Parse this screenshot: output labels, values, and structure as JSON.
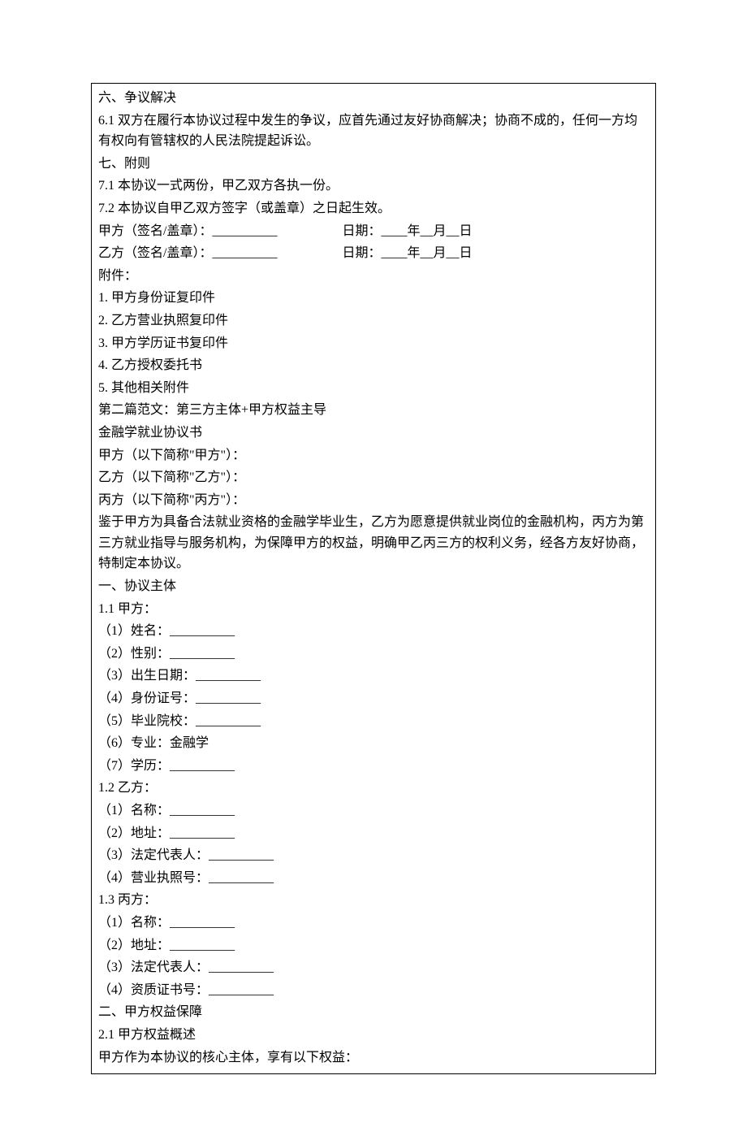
{
  "lines": [
    "六、争议解决",
    "6.1 双方在履行本协议过程中发生的争议，应首先通过友好协商解决；协商不成的，任何一方均有权向有管辖权的人民法院提起诉讼。",
    "七、附则",
    "7.1 本协议一式两份，甲乙双方各执一份。",
    "7.2 本协议自甲乙双方签字（或盖章）之日起生效。",
    "甲方（签名/盖章）：__________     日期：____年__月__日",
    "乙方（签名/盖章）：__________     日期：____年__月__日",
    "附件：",
    "1. 甲方身份证复印件",
    "2. 乙方营业执照复印件",
    "3. 甲方学历证书复印件",
    "4. 乙方授权委托书",
    "5. 其他相关附件",
    "第二篇范文：第三方主体+甲方权益主导",
    "金融学就业协议书",
    "甲方（以下简称\"甲方\"）：",
    "乙方（以下简称\"乙方\"）：",
    "丙方（以下简称\"丙方\"）：",
    "鉴于甲方为具备合法就业资格的金融学毕业生，乙方为愿意提供就业岗位的金融机构，丙方为第三方就业指导与服务机构，为保障甲方的权益，明确甲乙丙三方的权利义务，经各方友好协商，特制定本协议。",
    "一、协议主体",
    "1.1 甲方：",
    "（1）姓名：__________",
    "（2）性别：__________",
    "（3）出生日期：__________",
    "（4）身份证号：__________",
    "（5）毕业院校：__________",
    "（6）专业：金融学",
    "（7）学历：__________",
    "1.2 乙方：",
    "（1）名称：__________",
    "（2）地址：__________",
    "（3）法定代表人：__________",
    "（4）营业执照号：__________",
    "1.3 丙方：",
    "（1）名称：__________",
    "（2）地址：__________",
    "（3）法定代表人：__________",
    "（4）资质证书号：__________",
    "二、甲方权益保障",
    "2.1 甲方权益概述",
    "甲方作为本协议的核心主体，享有以下权益："
  ]
}
